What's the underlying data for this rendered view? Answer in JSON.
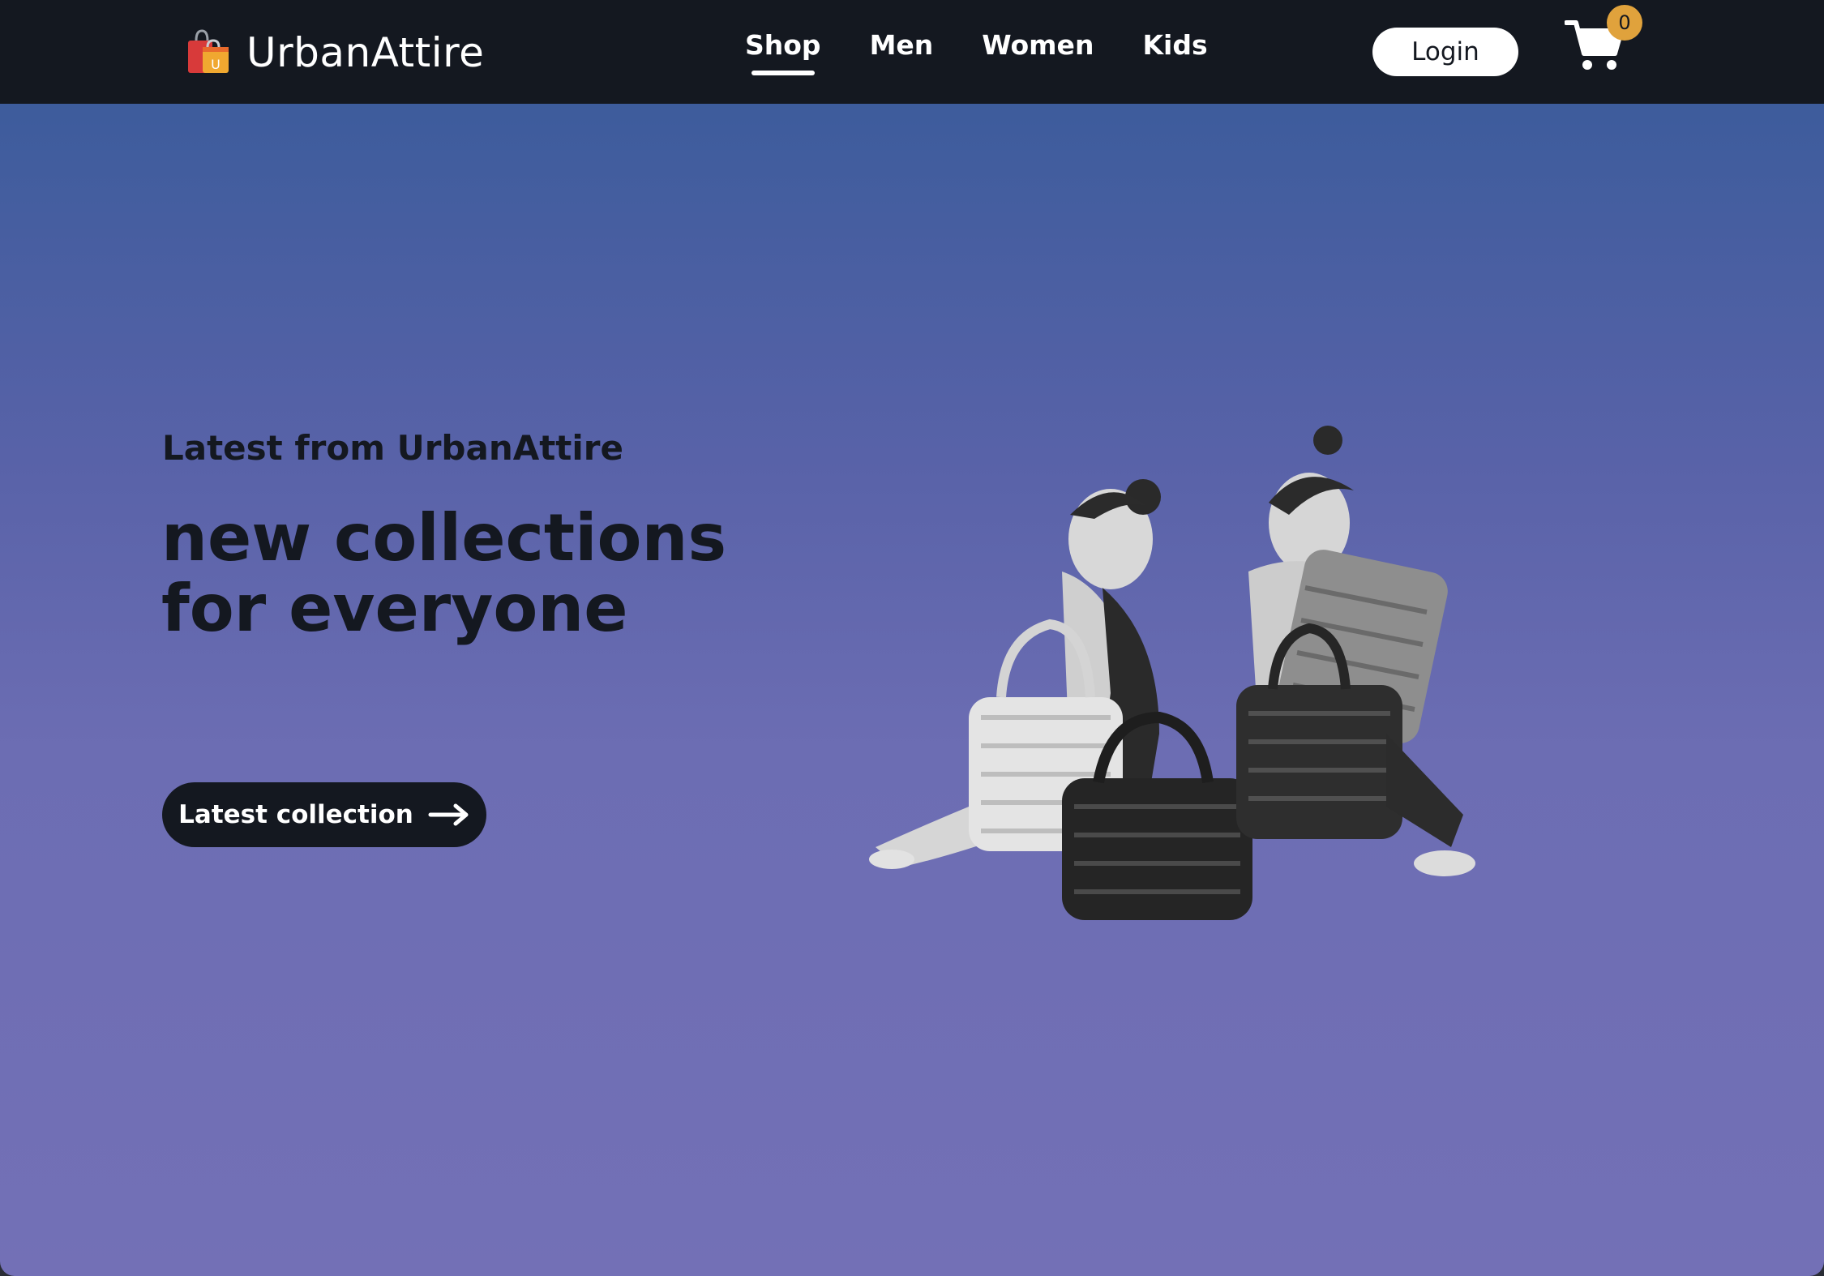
{
  "brand": {
    "name": "UrbanAttire",
    "logo_icon": "shopping-bags-icon",
    "logo_colors": [
      "#d83a3a",
      "#f0a830",
      "#e86a2c"
    ]
  },
  "nav": {
    "items": [
      {
        "label": "Shop",
        "active": true
      },
      {
        "label": "Men",
        "active": false
      },
      {
        "label": "Women",
        "active": false
      },
      {
        "label": "Kids",
        "active": false
      }
    ]
  },
  "header": {
    "login_label": "Login",
    "cart_icon": "cart-icon",
    "cart_count": "0"
  },
  "hero": {
    "eyebrow": "Latest from UrbanAttire",
    "headline": "new collections for everyone",
    "cta_label": "Latest collection",
    "cta_icon": "arrow-right-icon",
    "image": "hero-models-with-bags-image"
  },
  "colors": {
    "navbar_bg": "#141820",
    "hero_top": "#3d5c9c",
    "hero_bottom": "#7370b6",
    "badge": "#e0a23c",
    "text_dark": "#141820"
  }
}
